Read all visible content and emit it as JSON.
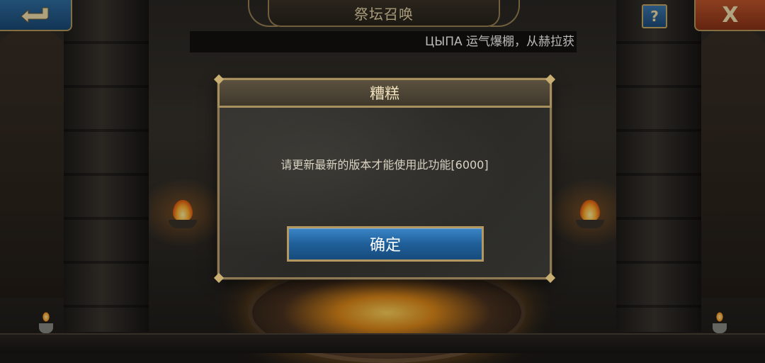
{
  "header": {
    "title": "祭坛召唤",
    "back_icon": "back-arrow-icon",
    "help_label": "?",
    "close_label": "X"
  },
  "ticker": {
    "text": "ЦЫПА 运气爆棚，从赫拉获"
  },
  "dialog": {
    "title": "糟糕",
    "message": "请更新最新的版本才能使用此功能[6000]",
    "confirm_label": "确定"
  },
  "colors": {
    "accent_blue": "#1f5f99",
    "close_red": "#a8421f",
    "gold_border": "#a78f5f"
  }
}
